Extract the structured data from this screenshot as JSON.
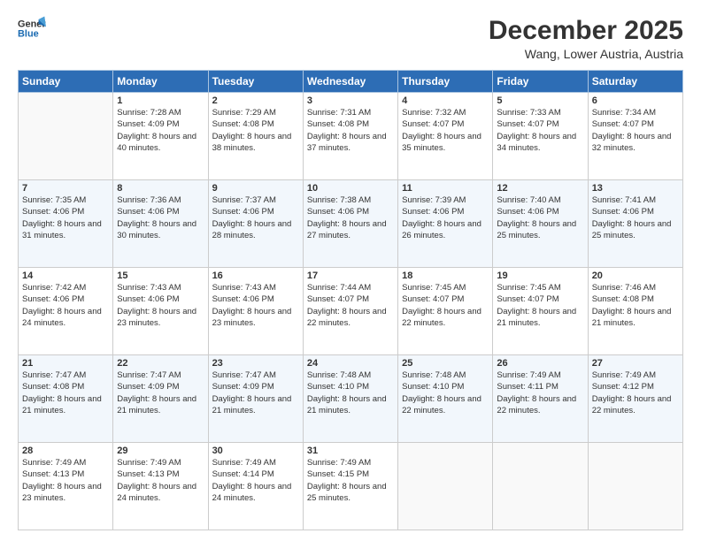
{
  "header": {
    "logo_line1": "General",
    "logo_line2": "Blue",
    "month": "December 2025",
    "location": "Wang, Lower Austria, Austria"
  },
  "weekdays": [
    "Sunday",
    "Monday",
    "Tuesday",
    "Wednesday",
    "Thursday",
    "Friday",
    "Saturday"
  ],
  "rows": [
    [
      {
        "day": "",
        "sunrise": "",
        "sunset": "",
        "daylight": ""
      },
      {
        "day": "1",
        "sunrise": "Sunrise: 7:28 AM",
        "sunset": "Sunset: 4:09 PM",
        "daylight": "Daylight: 8 hours and 40 minutes."
      },
      {
        "day": "2",
        "sunrise": "Sunrise: 7:29 AM",
        "sunset": "Sunset: 4:08 PM",
        "daylight": "Daylight: 8 hours and 38 minutes."
      },
      {
        "day": "3",
        "sunrise": "Sunrise: 7:31 AM",
        "sunset": "Sunset: 4:08 PM",
        "daylight": "Daylight: 8 hours and 37 minutes."
      },
      {
        "day": "4",
        "sunrise": "Sunrise: 7:32 AM",
        "sunset": "Sunset: 4:07 PM",
        "daylight": "Daylight: 8 hours and 35 minutes."
      },
      {
        "day": "5",
        "sunrise": "Sunrise: 7:33 AM",
        "sunset": "Sunset: 4:07 PM",
        "daylight": "Daylight: 8 hours and 34 minutes."
      },
      {
        "day": "6",
        "sunrise": "Sunrise: 7:34 AM",
        "sunset": "Sunset: 4:07 PM",
        "daylight": "Daylight: 8 hours and 32 minutes."
      }
    ],
    [
      {
        "day": "7",
        "sunrise": "Sunrise: 7:35 AM",
        "sunset": "Sunset: 4:06 PM",
        "daylight": "Daylight: 8 hours and 31 minutes."
      },
      {
        "day": "8",
        "sunrise": "Sunrise: 7:36 AM",
        "sunset": "Sunset: 4:06 PM",
        "daylight": "Daylight: 8 hours and 30 minutes."
      },
      {
        "day": "9",
        "sunrise": "Sunrise: 7:37 AM",
        "sunset": "Sunset: 4:06 PM",
        "daylight": "Daylight: 8 hours and 28 minutes."
      },
      {
        "day": "10",
        "sunrise": "Sunrise: 7:38 AM",
        "sunset": "Sunset: 4:06 PM",
        "daylight": "Daylight: 8 hours and 27 minutes."
      },
      {
        "day": "11",
        "sunrise": "Sunrise: 7:39 AM",
        "sunset": "Sunset: 4:06 PM",
        "daylight": "Daylight: 8 hours and 26 minutes."
      },
      {
        "day": "12",
        "sunrise": "Sunrise: 7:40 AM",
        "sunset": "Sunset: 4:06 PM",
        "daylight": "Daylight: 8 hours and 25 minutes."
      },
      {
        "day": "13",
        "sunrise": "Sunrise: 7:41 AM",
        "sunset": "Sunset: 4:06 PM",
        "daylight": "Daylight: 8 hours and 25 minutes."
      }
    ],
    [
      {
        "day": "14",
        "sunrise": "Sunrise: 7:42 AM",
        "sunset": "Sunset: 4:06 PM",
        "daylight": "Daylight: 8 hours and 24 minutes."
      },
      {
        "day": "15",
        "sunrise": "Sunrise: 7:43 AM",
        "sunset": "Sunset: 4:06 PM",
        "daylight": "Daylight: 8 hours and 23 minutes."
      },
      {
        "day": "16",
        "sunrise": "Sunrise: 7:43 AM",
        "sunset": "Sunset: 4:06 PM",
        "daylight": "Daylight: 8 hours and 23 minutes."
      },
      {
        "day": "17",
        "sunrise": "Sunrise: 7:44 AM",
        "sunset": "Sunset: 4:07 PM",
        "daylight": "Daylight: 8 hours and 22 minutes."
      },
      {
        "day": "18",
        "sunrise": "Sunrise: 7:45 AM",
        "sunset": "Sunset: 4:07 PM",
        "daylight": "Daylight: 8 hours and 22 minutes."
      },
      {
        "day": "19",
        "sunrise": "Sunrise: 7:45 AM",
        "sunset": "Sunset: 4:07 PM",
        "daylight": "Daylight: 8 hours and 21 minutes."
      },
      {
        "day": "20",
        "sunrise": "Sunrise: 7:46 AM",
        "sunset": "Sunset: 4:08 PM",
        "daylight": "Daylight: 8 hours and 21 minutes."
      }
    ],
    [
      {
        "day": "21",
        "sunrise": "Sunrise: 7:47 AM",
        "sunset": "Sunset: 4:08 PM",
        "daylight": "Daylight: 8 hours and 21 minutes."
      },
      {
        "day": "22",
        "sunrise": "Sunrise: 7:47 AM",
        "sunset": "Sunset: 4:09 PM",
        "daylight": "Daylight: 8 hours and 21 minutes."
      },
      {
        "day": "23",
        "sunrise": "Sunrise: 7:47 AM",
        "sunset": "Sunset: 4:09 PM",
        "daylight": "Daylight: 8 hours and 21 minutes."
      },
      {
        "day": "24",
        "sunrise": "Sunrise: 7:48 AM",
        "sunset": "Sunset: 4:10 PM",
        "daylight": "Daylight: 8 hours and 21 minutes."
      },
      {
        "day": "25",
        "sunrise": "Sunrise: 7:48 AM",
        "sunset": "Sunset: 4:10 PM",
        "daylight": "Daylight: 8 hours and 22 minutes."
      },
      {
        "day": "26",
        "sunrise": "Sunrise: 7:49 AM",
        "sunset": "Sunset: 4:11 PM",
        "daylight": "Daylight: 8 hours and 22 minutes."
      },
      {
        "day": "27",
        "sunrise": "Sunrise: 7:49 AM",
        "sunset": "Sunset: 4:12 PM",
        "daylight": "Daylight: 8 hours and 22 minutes."
      }
    ],
    [
      {
        "day": "28",
        "sunrise": "Sunrise: 7:49 AM",
        "sunset": "Sunset: 4:13 PM",
        "daylight": "Daylight: 8 hours and 23 minutes."
      },
      {
        "day": "29",
        "sunrise": "Sunrise: 7:49 AM",
        "sunset": "Sunset: 4:13 PM",
        "daylight": "Daylight: 8 hours and 24 minutes."
      },
      {
        "day": "30",
        "sunrise": "Sunrise: 7:49 AM",
        "sunset": "Sunset: 4:14 PM",
        "daylight": "Daylight: 8 hours and 24 minutes."
      },
      {
        "day": "31",
        "sunrise": "Sunrise: 7:49 AM",
        "sunset": "Sunset: 4:15 PM",
        "daylight": "Daylight: 8 hours and 25 minutes."
      },
      {
        "day": "",
        "sunrise": "",
        "sunset": "",
        "daylight": ""
      },
      {
        "day": "",
        "sunrise": "",
        "sunset": "",
        "daylight": ""
      },
      {
        "day": "",
        "sunrise": "",
        "sunset": "",
        "daylight": ""
      }
    ]
  ]
}
